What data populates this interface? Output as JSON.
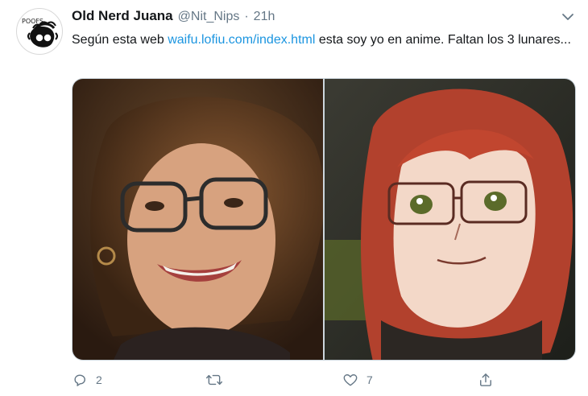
{
  "tweet": {
    "author": {
      "display_name": "Old Nerd Juana",
      "handle": "@Nit_Nips",
      "separator": "·",
      "timestamp": "21h",
      "avatar_caption": "POOFS"
    },
    "text": {
      "before_link": "Según esta web ",
      "link": "waifu.lofiu.com/index.html",
      "after_link": " esta soy yo en anime. Faltan los 3 lunares..."
    },
    "media": [
      {
        "kind": "photo",
        "subject": "real-photo-curly-hair-glasses"
      },
      {
        "kind": "photo",
        "subject": "anime-version-red-hair-glasses"
      }
    ],
    "actions": {
      "reply_count": "2",
      "retweet_count": "",
      "like_count": "7"
    },
    "colors": {
      "link": "#1b95e0",
      "secondary_text": "#657786",
      "primary_text": "#14171a"
    },
    "icons": [
      "chevron-down-icon",
      "reply-icon",
      "retweet-icon",
      "like-icon",
      "share-icon"
    ]
  }
}
